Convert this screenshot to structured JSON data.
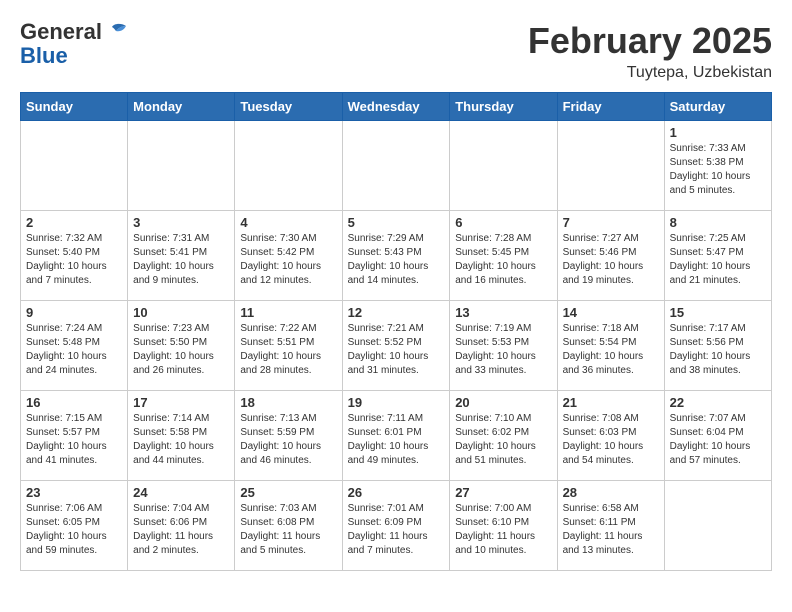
{
  "header": {
    "logo_general": "General",
    "logo_blue": "Blue",
    "month_title": "February 2025",
    "location": "Tuytepa, Uzbekistan"
  },
  "weekdays": [
    "Sunday",
    "Monday",
    "Tuesday",
    "Wednesday",
    "Thursday",
    "Friday",
    "Saturday"
  ],
  "weeks": [
    [
      {
        "day": "",
        "info": ""
      },
      {
        "day": "",
        "info": ""
      },
      {
        "day": "",
        "info": ""
      },
      {
        "day": "",
        "info": ""
      },
      {
        "day": "",
        "info": ""
      },
      {
        "day": "",
        "info": ""
      },
      {
        "day": "1",
        "info": "Sunrise: 7:33 AM\nSunset: 5:38 PM\nDaylight: 10 hours and 5 minutes."
      }
    ],
    [
      {
        "day": "2",
        "info": "Sunrise: 7:32 AM\nSunset: 5:40 PM\nDaylight: 10 hours and 7 minutes."
      },
      {
        "day": "3",
        "info": "Sunrise: 7:31 AM\nSunset: 5:41 PM\nDaylight: 10 hours and 9 minutes."
      },
      {
        "day": "4",
        "info": "Sunrise: 7:30 AM\nSunset: 5:42 PM\nDaylight: 10 hours and 12 minutes."
      },
      {
        "day": "5",
        "info": "Sunrise: 7:29 AM\nSunset: 5:43 PM\nDaylight: 10 hours and 14 minutes."
      },
      {
        "day": "6",
        "info": "Sunrise: 7:28 AM\nSunset: 5:45 PM\nDaylight: 10 hours and 16 minutes."
      },
      {
        "day": "7",
        "info": "Sunrise: 7:27 AM\nSunset: 5:46 PM\nDaylight: 10 hours and 19 minutes."
      },
      {
        "day": "8",
        "info": "Sunrise: 7:25 AM\nSunset: 5:47 PM\nDaylight: 10 hours and 21 minutes."
      }
    ],
    [
      {
        "day": "9",
        "info": "Sunrise: 7:24 AM\nSunset: 5:48 PM\nDaylight: 10 hours and 24 minutes."
      },
      {
        "day": "10",
        "info": "Sunrise: 7:23 AM\nSunset: 5:50 PM\nDaylight: 10 hours and 26 minutes."
      },
      {
        "day": "11",
        "info": "Sunrise: 7:22 AM\nSunset: 5:51 PM\nDaylight: 10 hours and 28 minutes."
      },
      {
        "day": "12",
        "info": "Sunrise: 7:21 AM\nSunset: 5:52 PM\nDaylight: 10 hours and 31 minutes."
      },
      {
        "day": "13",
        "info": "Sunrise: 7:19 AM\nSunset: 5:53 PM\nDaylight: 10 hours and 33 minutes."
      },
      {
        "day": "14",
        "info": "Sunrise: 7:18 AM\nSunset: 5:54 PM\nDaylight: 10 hours and 36 minutes."
      },
      {
        "day": "15",
        "info": "Sunrise: 7:17 AM\nSunset: 5:56 PM\nDaylight: 10 hours and 38 minutes."
      }
    ],
    [
      {
        "day": "16",
        "info": "Sunrise: 7:15 AM\nSunset: 5:57 PM\nDaylight: 10 hours and 41 minutes."
      },
      {
        "day": "17",
        "info": "Sunrise: 7:14 AM\nSunset: 5:58 PM\nDaylight: 10 hours and 44 minutes."
      },
      {
        "day": "18",
        "info": "Sunrise: 7:13 AM\nSunset: 5:59 PM\nDaylight: 10 hours and 46 minutes."
      },
      {
        "day": "19",
        "info": "Sunrise: 7:11 AM\nSunset: 6:01 PM\nDaylight: 10 hours and 49 minutes."
      },
      {
        "day": "20",
        "info": "Sunrise: 7:10 AM\nSunset: 6:02 PM\nDaylight: 10 hours and 51 minutes."
      },
      {
        "day": "21",
        "info": "Sunrise: 7:08 AM\nSunset: 6:03 PM\nDaylight: 10 hours and 54 minutes."
      },
      {
        "day": "22",
        "info": "Sunrise: 7:07 AM\nSunset: 6:04 PM\nDaylight: 10 hours and 57 minutes."
      }
    ],
    [
      {
        "day": "23",
        "info": "Sunrise: 7:06 AM\nSunset: 6:05 PM\nDaylight: 10 hours and 59 minutes."
      },
      {
        "day": "24",
        "info": "Sunrise: 7:04 AM\nSunset: 6:06 PM\nDaylight: 11 hours and 2 minutes."
      },
      {
        "day": "25",
        "info": "Sunrise: 7:03 AM\nSunset: 6:08 PM\nDaylight: 11 hours and 5 minutes."
      },
      {
        "day": "26",
        "info": "Sunrise: 7:01 AM\nSunset: 6:09 PM\nDaylight: 11 hours and 7 minutes."
      },
      {
        "day": "27",
        "info": "Sunrise: 7:00 AM\nSunset: 6:10 PM\nDaylight: 11 hours and 10 minutes."
      },
      {
        "day": "28",
        "info": "Sunrise: 6:58 AM\nSunset: 6:11 PM\nDaylight: 11 hours and 13 minutes."
      },
      {
        "day": "",
        "info": ""
      }
    ]
  ]
}
